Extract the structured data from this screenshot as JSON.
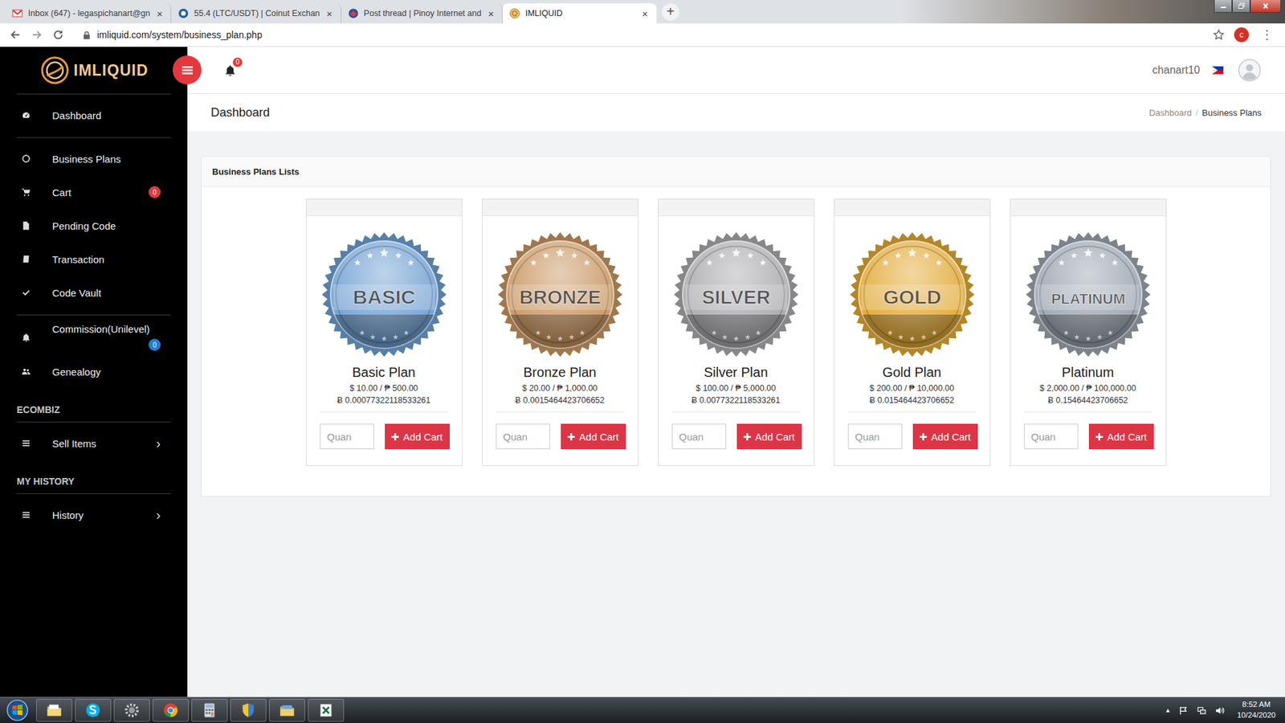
{
  "browser": {
    "tabs": [
      {
        "label": "Inbox (647) - legaspichanart@gn",
        "close": "×",
        "selected": false
      },
      {
        "label": "55.4 (LTC/USDT) | Coinut Exchan",
        "close": "×",
        "selected": false
      },
      {
        "label": "Post thread | Pinoy Internet and",
        "close": "×",
        "selected": false
      },
      {
        "label": "IMLIQUID",
        "close": "×",
        "selected": true
      }
    ],
    "new_tab": "+",
    "url": "imliquid.com/system/business_plan.php",
    "profile": "c",
    "menu": "⋮"
  },
  "header": {
    "logo": "IMLIQUID",
    "notifications": "0",
    "user": "chanart10"
  },
  "sidebar": {
    "groups": [
      {
        "items": [
          {
            "label": "Dashboard"
          }
        ]
      },
      {
        "items": [
          {
            "label": "Business Plans"
          },
          {
            "label": "Cart",
            "badge": {
              "text": "0",
              "color": "#e0393e"
            }
          },
          {
            "label": "Pending Code"
          },
          {
            "label": "Transaction"
          },
          {
            "label": "Code Vault"
          }
        ]
      },
      {
        "items": [
          {
            "label": "Commission(Unilevel)",
            "badge": {
              "text": "0",
              "color": "#1e7fd6"
            }
          },
          {
            "label": "Genealogy"
          }
        ]
      },
      {
        "heading": "ECOMBIZ",
        "items": [
          {
            "label": "Sell Items",
            "arrow": "›"
          }
        ]
      },
      {
        "heading": "MY HISTORY",
        "items": [
          {
            "label": "History",
            "arrow": "›"
          }
        ]
      }
    ]
  },
  "page": {
    "title": "Dashboard",
    "separator": "/",
    "breadcrumb": [
      {
        "label": "Dashboard",
        "selected": false
      },
      {
        "label": "Business Plans",
        "selected": true
      }
    ]
  },
  "panel": {
    "title": "Business Plans Lists"
  },
  "plans": [
    {
      "badge": "BASIC",
      "name": "Basic Plan",
      "price": "$ 10.00 / ₱ 500.00",
      "btc": "Ƀ 0.00077322118533261",
      "placeholder": "Quan",
      "button": "Add Cart",
      "color": "#6f9fd2"
    },
    {
      "badge": "BRONZE",
      "name": "Bronze Plan",
      "price": "$ 20.00 / ₱ 1,000.00",
      "btc": "Ƀ 0.0015464423706652",
      "placeholder": "Quan",
      "button": "Add Cart",
      "color": "#c99560"
    },
    {
      "badge": "SILVER",
      "name": "Silver Plan",
      "price": "$ 100.00 / ₱ 5,000.00",
      "btc": "Ƀ 0.0077322118533261",
      "placeholder": "Quan",
      "button": "Add Cart",
      "color": "#a9a9ad"
    },
    {
      "badge": "GOLD",
      "name": "Gold Plan",
      "price": "$ 200.00 / ₱ 10,000.00",
      "btc": "Ƀ 0.015464423706652",
      "placeholder": "Quan",
      "button": "Add Cart",
      "color": "#e2a832"
    },
    {
      "badge": "PLATINUM",
      "name": "Platinum",
      "price": "$ 2,000.00 / ₱ 100,000.00",
      "btc": "Ƀ 0.15464423706652",
      "placeholder": "Quan",
      "button": "Add Cart",
      "color": "#9aa4b0"
    }
  ],
  "taskbar": {
    "tray_arrow": "▲",
    "time": "8:52 AM",
    "date": "10/24/2020"
  }
}
